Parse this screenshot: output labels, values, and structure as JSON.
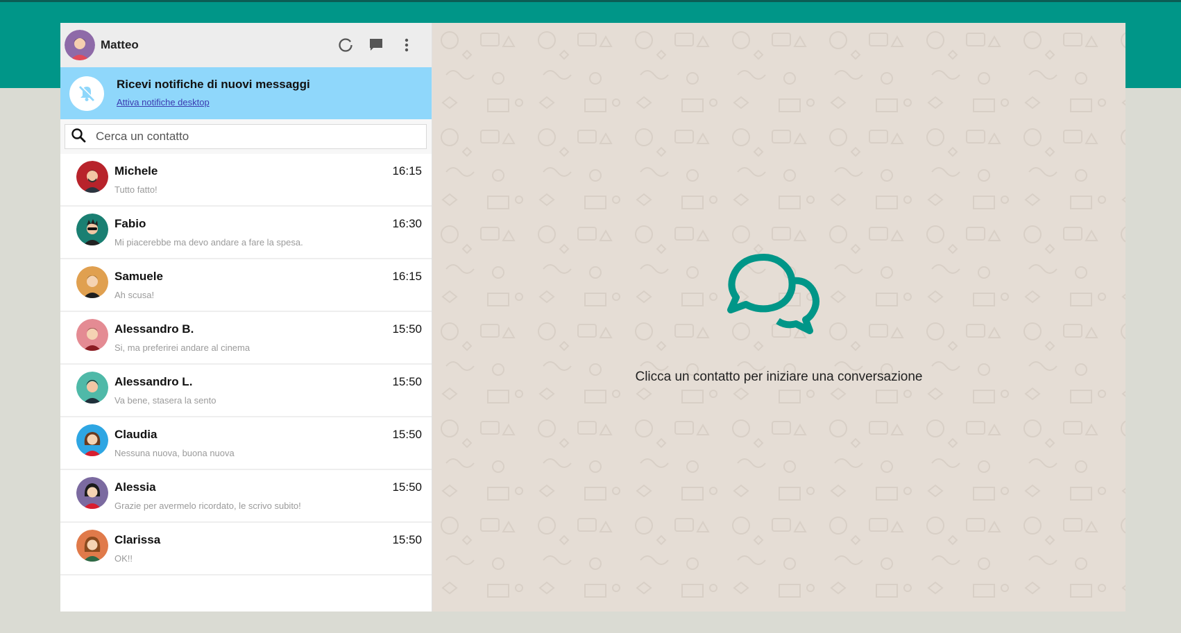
{
  "colors": {
    "brand_teal": "#009688",
    "notification_bg": "#8fd7fb",
    "chat_bg": "#e5ddd5"
  },
  "header": {
    "user_name": "Matteo",
    "icons": [
      "status-icon",
      "new-chat-icon",
      "menu-icon"
    ]
  },
  "notification": {
    "title": "Ricevi notifiche di nuovi messaggi",
    "link": "Attiva notifiche desktop"
  },
  "search": {
    "placeholder": "Cerca un contatto",
    "value": ""
  },
  "contacts": [
    {
      "name": "Michele",
      "time": "16:15",
      "message": "Tutto fatto!",
      "avatar_color": "#b8232b"
    },
    {
      "name": "Fabio",
      "time": "16:30",
      "message": "Mi piacerebbe ma devo andare a fare la spesa.",
      "avatar_color": "#1a7f72"
    },
    {
      "name": "Samuele",
      "time": "16:15",
      "message": "Ah scusa!",
      "avatar_color": "#e0a050"
    },
    {
      "name": "Alessandro B.",
      "time": "15:50",
      "message": "Si, ma preferirei andare al cinema",
      "avatar_color": "#e48b93"
    },
    {
      "name": "Alessandro L.",
      "time": "15:50",
      "message": "Va bene, stasera la sento",
      "avatar_color": "#4fb9a8"
    },
    {
      "name": "Claudia",
      "time": "15:50",
      "message": "Nessuna nuova, buona nuova",
      "avatar_color": "#2ea6e3"
    },
    {
      "name": "Alessia",
      "time": "15:50",
      "message": "Grazie per avermelo ricordato, le scrivo subito!",
      "avatar_color": "#7b6aa0"
    },
    {
      "name": "Clarissa",
      "time": "15:50",
      "message": "OK!!",
      "avatar_color": "#e07a4a"
    }
  ],
  "main": {
    "empty_text": "Clicca un contatto per iniziare una conversazione",
    "icon": "chat-bubbles-icon"
  }
}
